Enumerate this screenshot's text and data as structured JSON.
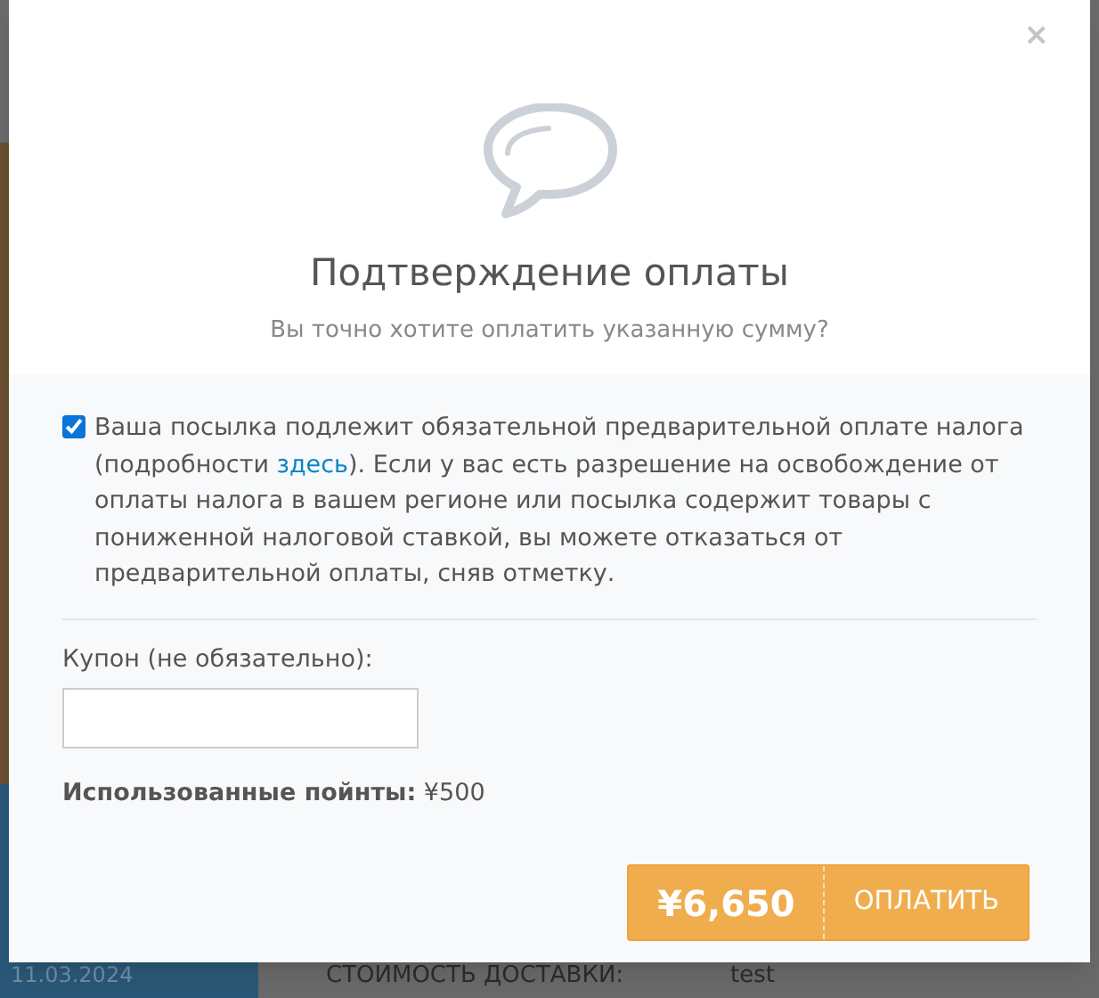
{
  "background": {
    "date": "11.03.2024",
    "shipping_label": "СТОИМОСТЬ ДОСТАВКИ:",
    "shipping_value": "test"
  },
  "dialog": {
    "close": "×",
    "title": "Подтверждение оплаты",
    "subtitle": "Вы точно хотите оплатить указанную сумму?",
    "tax_notice": {
      "checked": true,
      "text_before": "Ваша посылка подлежит обязательной предварительной оплате налога (подробности ",
      "link": "здесь",
      "text_after": "). Если у вас есть разрешение на освобождение от оплаты налога в вашем регионе или посылка содержит товары с пониженной налоговой ставкой, вы можете отказаться от предварительной оплаты, сняв отметку."
    },
    "coupon": {
      "label": "Купон (не обязательно):"
    },
    "points": {
      "label": "Использованные пойнты:",
      "value": "¥500"
    },
    "pay_button": {
      "amount": "¥6,650",
      "label": "ОПЛАТИТЬ"
    }
  }
}
